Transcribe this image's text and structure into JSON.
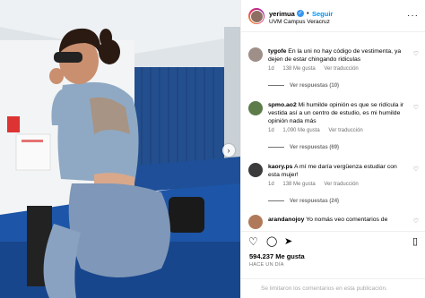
{
  "post": {
    "username": "yerimua",
    "follow_label": "Seguir",
    "separator": "•",
    "location": "UVM Campus Veracruz",
    "likes": "594.237 Me gusta",
    "time": "HACE UN DÍA",
    "comments_limited": "Se limitaron los comentarios en esta publicación.",
    "colors": {
      "accent": "#0095f6",
      "verified": "#3897f0",
      "muted": "#737373"
    }
  },
  "comments": [
    {
      "username": "tygofe",
      "text": "En la uni no hay código de vestimenta, ya dejen de estar chingando ridiculas",
      "time": "1d",
      "likes": "138 Me gusta",
      "reply": "Ver traducción",
      "replies": "Ver respuestas (10)"
    },
    {
      "username": "spmo.ao2",
      "text": "Mi humilde opinión es que se ridícula ir vestida así a un centro de estudio, es mi humilde opinión nada más",
      "time": "1d",
      "likes": "1,090 Me gusta",
      "reply": "Ver traducción",
      "replies": "Ver respuestas (69)"
    },
    {
      "username": "kaory.ps",
      "text": "A mí me daría vergüenza estudiar con esta mujer!",
      "time": "1d",
      "likes": "138 Me gusta",
      "reply": "Ver traducción",
      "replies": "Ver respuestas (24)"
    },
    {
      "username": "arandanojoy",
      "text": "Yo nomás veo comentarios de"
    }
  ]
}
